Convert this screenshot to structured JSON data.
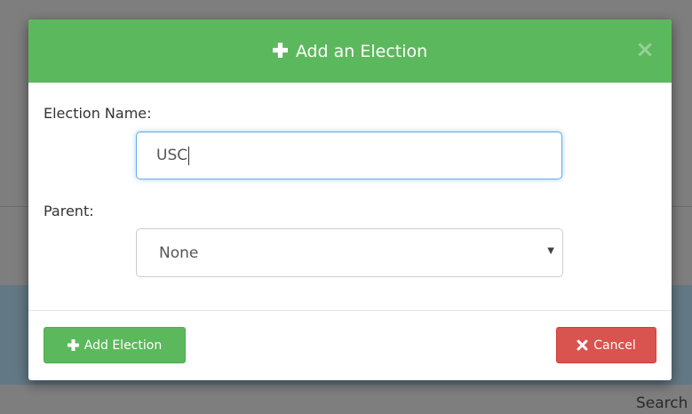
{
  "background": {
    "search_label": "Search"
  },
  "modal": {
    "title": "Add an Election",
    "close_glyph": "×",
    "fields": {
      "name_label": "Election Name:",
      "name_value": "USC",
      "parent_label": "Parent:",
      "parent_selected": "None"
    },
    "buttons": {
      "add_label": "Add Election",
      "cancel_label": "Cancel"
    },
    "colors": {
      "header": "#5cb85c",
      "add_button": "#5cb85c",
      "cancel_button": "#d9534f",
      "input_focus": "#66afe9"
    },
    "icons": {
      "title": "plus-icon",
      "add": "plus-icon",
      "cancel": "times-icon",
      "select": "caret-down-icon"
    }
  }
}
